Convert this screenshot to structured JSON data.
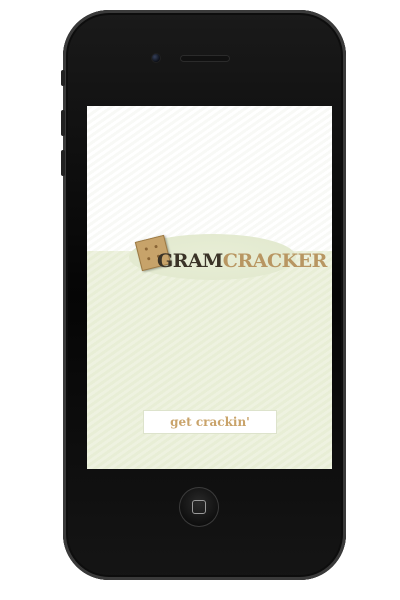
{
  "app": {
    "logo": {
      "gram": "GRAM",
      "cracker": "CRACKER"
    },
    "cta_label": "get crackin'"
  },
  "device": {
    "type": "iPhone",
    "home_button_icon": "home-square-icon"
  },
  "colors": {
    "logo_dark": "#3a3327",
    "logo_tan": "#b89662",
    "button_text": "#c9a36a",
    "screen_bottom_bg": "#eef2e0"
  }
}
